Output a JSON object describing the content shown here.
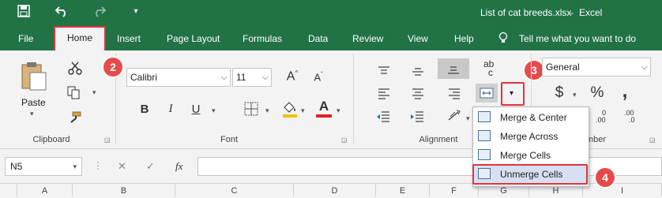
{
  "titlebar": {
    "save_icon": "save-icon",
    "undo_icon": "undo-icon",
    "redo_icon": "redo-icon",
    "customize_icon": "customize-qat-icon",
    "filename": "List of cat breeds.xlsx",
    "separator": "-",
    "app": "Excel"
  },
  "tabs": [
    "File",
    "Home",
    "Insert",
    "Page Layout",
    "Formulas",
    "Data",
    "Review",
    "View",
    "Help"
  ],
  "tell_me": "Tell me what you want to do",
  "clipboard": {
    "paste": "Paste",
    "group_label": "Clipboard"
  },
  "font": {
    "name": "Calibri",
    "size": "11",
    "bold": "B",
    "italic": "I",
    "underline": "U",
    "grow": "A",
    "shrink": "A",
    "color_letter": "A",
    "group_label": "Font"
  },
  "alignment": {
    "wrap": "ab",
    "wrap_sub": "c",
    "group_label": "Alignment"
  },
  "number": {
    "format": "General",
    "currency": "$",
    "percent": "%",
    "comma": ",",
    "dec_inc_top": "0",
    "dec_inc_bottom": ".00",
    "dec_dec_top": ".00",
    "dec_dec_bottom": ".0",
    "group_label": "Number",
    "group_label_visible": "mber"
  },
  "merge_menu": {
    "items": [
      "Merge & Center",
      "Merge Across",
      "Merge Cells",
      "Unmerge Cells"
    ]
  },
  "badges": [
    "2",
    "3",
    "4"
  ],
  "formula_bar": {
    "namebox": "N5",
    "cancel": "✕",
    "enter": "✓",
    "fx": "fx"
  },
  "columns": [
    "A",
    "B",
    "C",
    "D",
    "E",
    "F",
    "G",
    "H",
    "I"
  ],
  "colors": {
    "excel_green": "#217346",
    "callout_red": "#e0343c"
  }
}
